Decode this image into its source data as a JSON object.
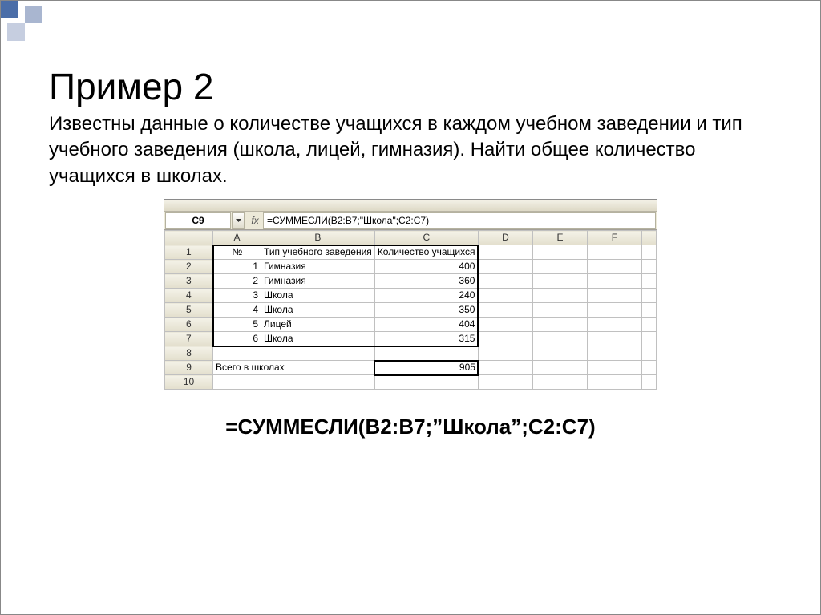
{
  "title": "Пример 2",
  "description": "Известны данные о количестве учащихся в каждом учебном заведении и тип учебного заведения (школа, лицей, гимназия). Найти общее количество учащихся в школах.",
  "excel": {
    "selected_cell": "C9",
    "fx_label": "fx",
    "formula_bar": "=СУММЕСЛИ(B2:B7;\"Школа\";C2:C7)",
    "columns": [
      "A",
      "B",
      "C",
      "D",
      "E",
      "F"
    ],
    "rows": [
      "1",
      "2",
      "3",
      "4",
      "5",
      "6",
      "7",
      "8",
      "9",
      "10"
    ],
    "headers": {
      "A": "№",
      "B": "Тип учебного заведения",
      "C": "Количество учащихся"
    },
    "data": [
      {
        "n": "1",
        "type": "Гимназия",
        "count": "400"
      },
      {
        "n": "2",
        "type": "Гимназия",
        "count": "360"
      },
      {
        "n": "3",
        "type": "Школа",
        "count": "240"
      },
      {
        "n": "4",
        "type": "Школа",
        "count": "350"
      },
      {
        "n": "5",
        "type": "Лицей",
        "count": "404"
      },
      {
        "n": "6",
        "type": "Школа",
        "count": "315"
      }
    ],
    "total_label": "Всего в школах",
    "total_value": "905"
  },
  "formula_display": "=СУММЕСЛИ(B2:B7;”Школа”;C2:C7)"
}
